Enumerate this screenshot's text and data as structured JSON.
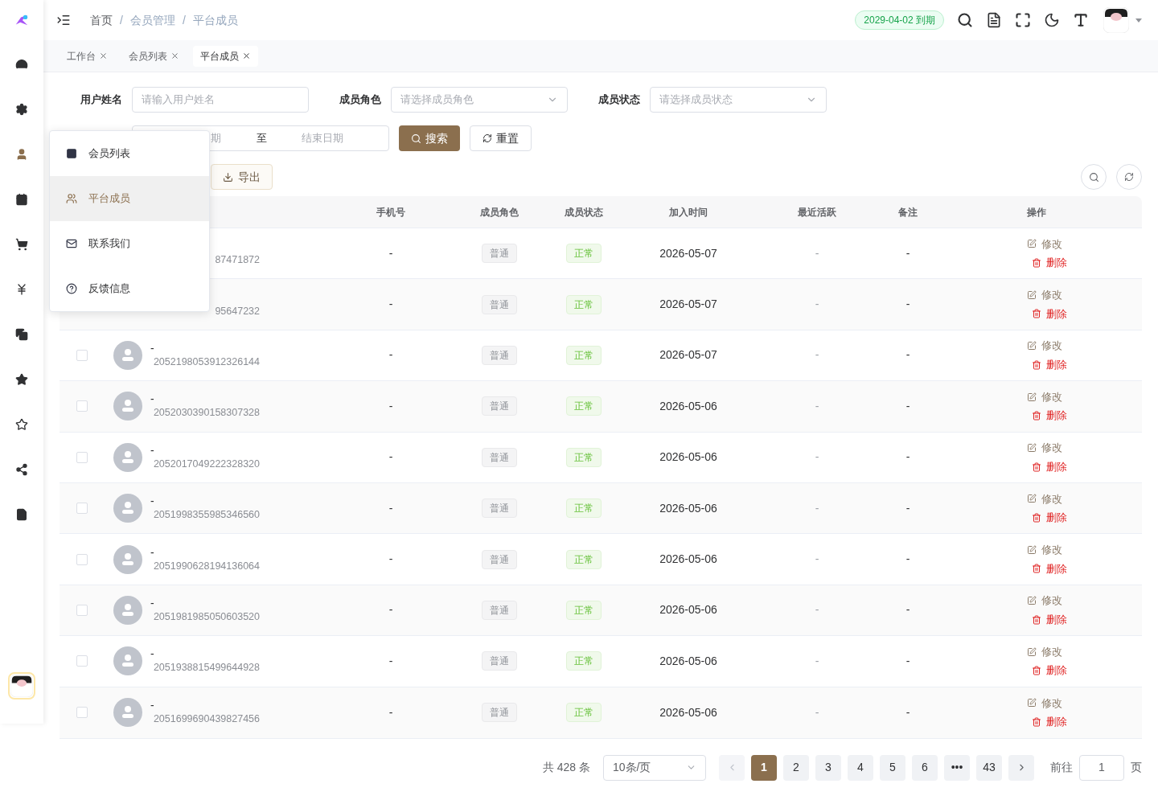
{
  "sidebar": {
    "items": [
      {
        "selected": false
      },
      {
        "selected": false
      },
      {
        "selected": true
      },
      {
        "selected": false
      },
      {
        "selected": false
      },
      {
        "selected": false
      },
      {
        "selected": false
      },
      {
        "selected": false
      },
      {
        "selected": false
      },
      {
        "selected": false
      },
      {
        "selected": false
      }
    ]
  },
  "breadcrumb": [
    "首页",
    "/",
    "会员管理",
    "/",
    "平台成员"
  ],
  "expiry_badge": "2029-04-02 到期",
  "tabs": [
    {
      "label": "工作台",
      "selected": false
    },
    {
      "label": "会员列表",
      "selected": false
    },
    {
      "label": "平台成员",
      "selected": true
    }
  ],
  "filters": [
    {
      "label": "用户姓名",
      "kind": "input",
      "placeholder": "请输入用户姓名"
    },
    {
      "label": "成员角色",
      "kind": "select",
      "placeholder": "请选择成员角色"
    },
    {
      "label": "成员状态",
      "kind": "select",
      "placeholder": "请选择成员状态"
    }
  ],
  "date_range": {
    "start_placeholder": "期",
    "separator": "至",
    "end_placeholder": "结束日期"
  },
  "search_button": "搜索",
  "reset_button": "重置",
  "export_button": "导出",
  "table": {
    "columns": [
      "手机号",
      "成员角色",
      "成员状态",
      "加入时间",
      "最近活跃",
      "备注",
      "操作"
    ],
    "rows": [
      {
        "id": "87471872",
        "phone": "-",
        "role": "普通",
        "status": "正常",
        "joined": "2026-05-07",
        "last_active": "-",
        "remark": "-",
        "edit": "修改",
        "delete": "删除"
      },
      {
        "id": "95647232",
        "phone": "-",
        "role": "普通",
        "status": "正常",
        "joined": "2026-05-07",
        "last_active": "-",
        "remark": "-",
        "edit": "修改",
        "delete": "删除"
      },
      {
        "name": "-",
        "checked": false,
        "id": "2052198053912326144",
        "phone": "-",
        "role": "普通",
        "status": "正常",
        "joined": "2026-05-07",
        "last_active": "-",
        "remark": "-",
        "edit": "修改",
        "delete": "删除"
      },
      {
        "name": "-",
        "checked": false,
        "id": "2052030390158307328",
        "phone": "-",
        "role": "普通",
        "status": "正常",
        "joined": "2026-05-06",
        "last_active": "-",
        "remark": "-",
        "edit": "修改",
        "delete": "删除"
      },
      {
        "name": "-",
        "checked": false,
        "id": "2052017049222328320",
        "phone": "-",
        "role": "普通",
        "status": "正常",
        "joined": "2026-05-06",
        "last_active": "-",
        "remark": "-",
        "edit": "修改",
        "delete": "删除"
      },
      {
        "name": "-",
        "checked": false,
        "id": "2051998355985346560",
        "phone": "-",
        "role": "普通",
        "status": "正常",
        "joined": "2026-05-06",
        "last_active": "-",
        "remark": "-",
        "edit": "修改",
        "delete": "删除"
      },
      {
        "name": "-",
        "checked": false,
        "id": "2051990628194136064",
        "phone": "-",
        "role": "普通",
        "status": "正常",
        "joined": "2026-05-06",
        "last_active": "-",
        "remark": "-",
        "edit": "修改",
        "delete": "删除"
      },
      {
        "name": "-",
        "checked": false,
        "id": "2051981985050603520",
        "phone": "-",
        "role": "普通",
        "status": "正常",
        "joined": "2026-05-06",
        "last_active": "-",
        "remark": "-",
        "edit": "修改",
        "delete": "删除"
      },
      {
        "name": "-",
        "checked": false,
        "id": "2051938815499644928",
        "phone": "-",
        "role": "普通",
        "status": "正常",
        "joined": "2026-05-06",
        "last_active": "-",
        "remark": "-",
        "edit": "修改",
        "delete": "删除"
      },
      {
        "name": "-",
        "checked": false,
        "id": "2051699690439827456",
        "phone": "-",
        "role": "普通",
        "status": "正常",
        "joined": "2026-05-06",
        "last_active": "-",
        "remark": "-",
        "edit": "修改",
        "delete": "删除"
      }
    ]
  },
  "pagination": {
    "total": "共 428 条",
    "page_size": "10条/页",
    "pages": [
      {
        "label": "1",
        "selected": true
      },
      {
        "label": "2",
        "selected": false
      },
      {
        "label": "3",
        "selected": false
      },
      {
        "label": "4",
        "selected": false
      },
      {
        "label": "5",
        "selected": false
      },
      {
        "label": "6",
        "selected": false
      },
      {
        "label": "•••",
        "selected": false
      },
      {
        "label": "43",
        "selected": false
      }
    ],
    "goto_label": "前往",
    "goto_value": "1",
    "page_unit": "页"
  },
  "popup_menu": [
    {
      "label": "会员列表",
      "selected": false
    },
    {
      "label": "平台成员",
      "selected": true
    },
    {
      "label": "联系我们",
      "selected": false
    },
    {
      "label": "反馈信息",
      "selected": false
    }
  ]
}
